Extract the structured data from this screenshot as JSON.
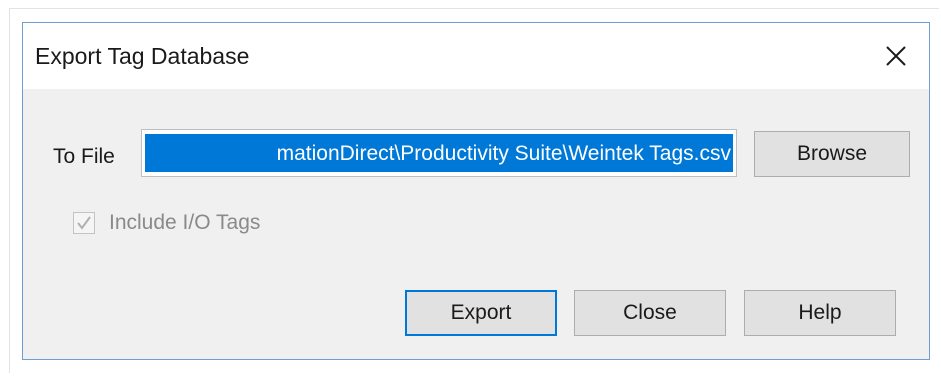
{
  "dialog": {
    "title": "Export Tag Database",
    "close_icon": "close-icon"
  },
  "form": {
    "to_file_label": "To File",
    "file_path_visible": "mationDirect\\Productivity Suite\\Weintek Tags.csv",
    "browse_label": "Browse",
    "include_io_label": "Include I/O Tags",
    "include_io_checked": true,
    "include_io_enabled": false
  },
  "buttons": {
    "export": "Export",
    "close": "Close",
    "help": "Help"
  },
  "colors": {
    "selection": "#0078d7",
    "dialog_border": "#6d9fcf",
    "client_bg": "#f0f0f0",
    "disabled_text": "#8a8a8a"
  }
}
